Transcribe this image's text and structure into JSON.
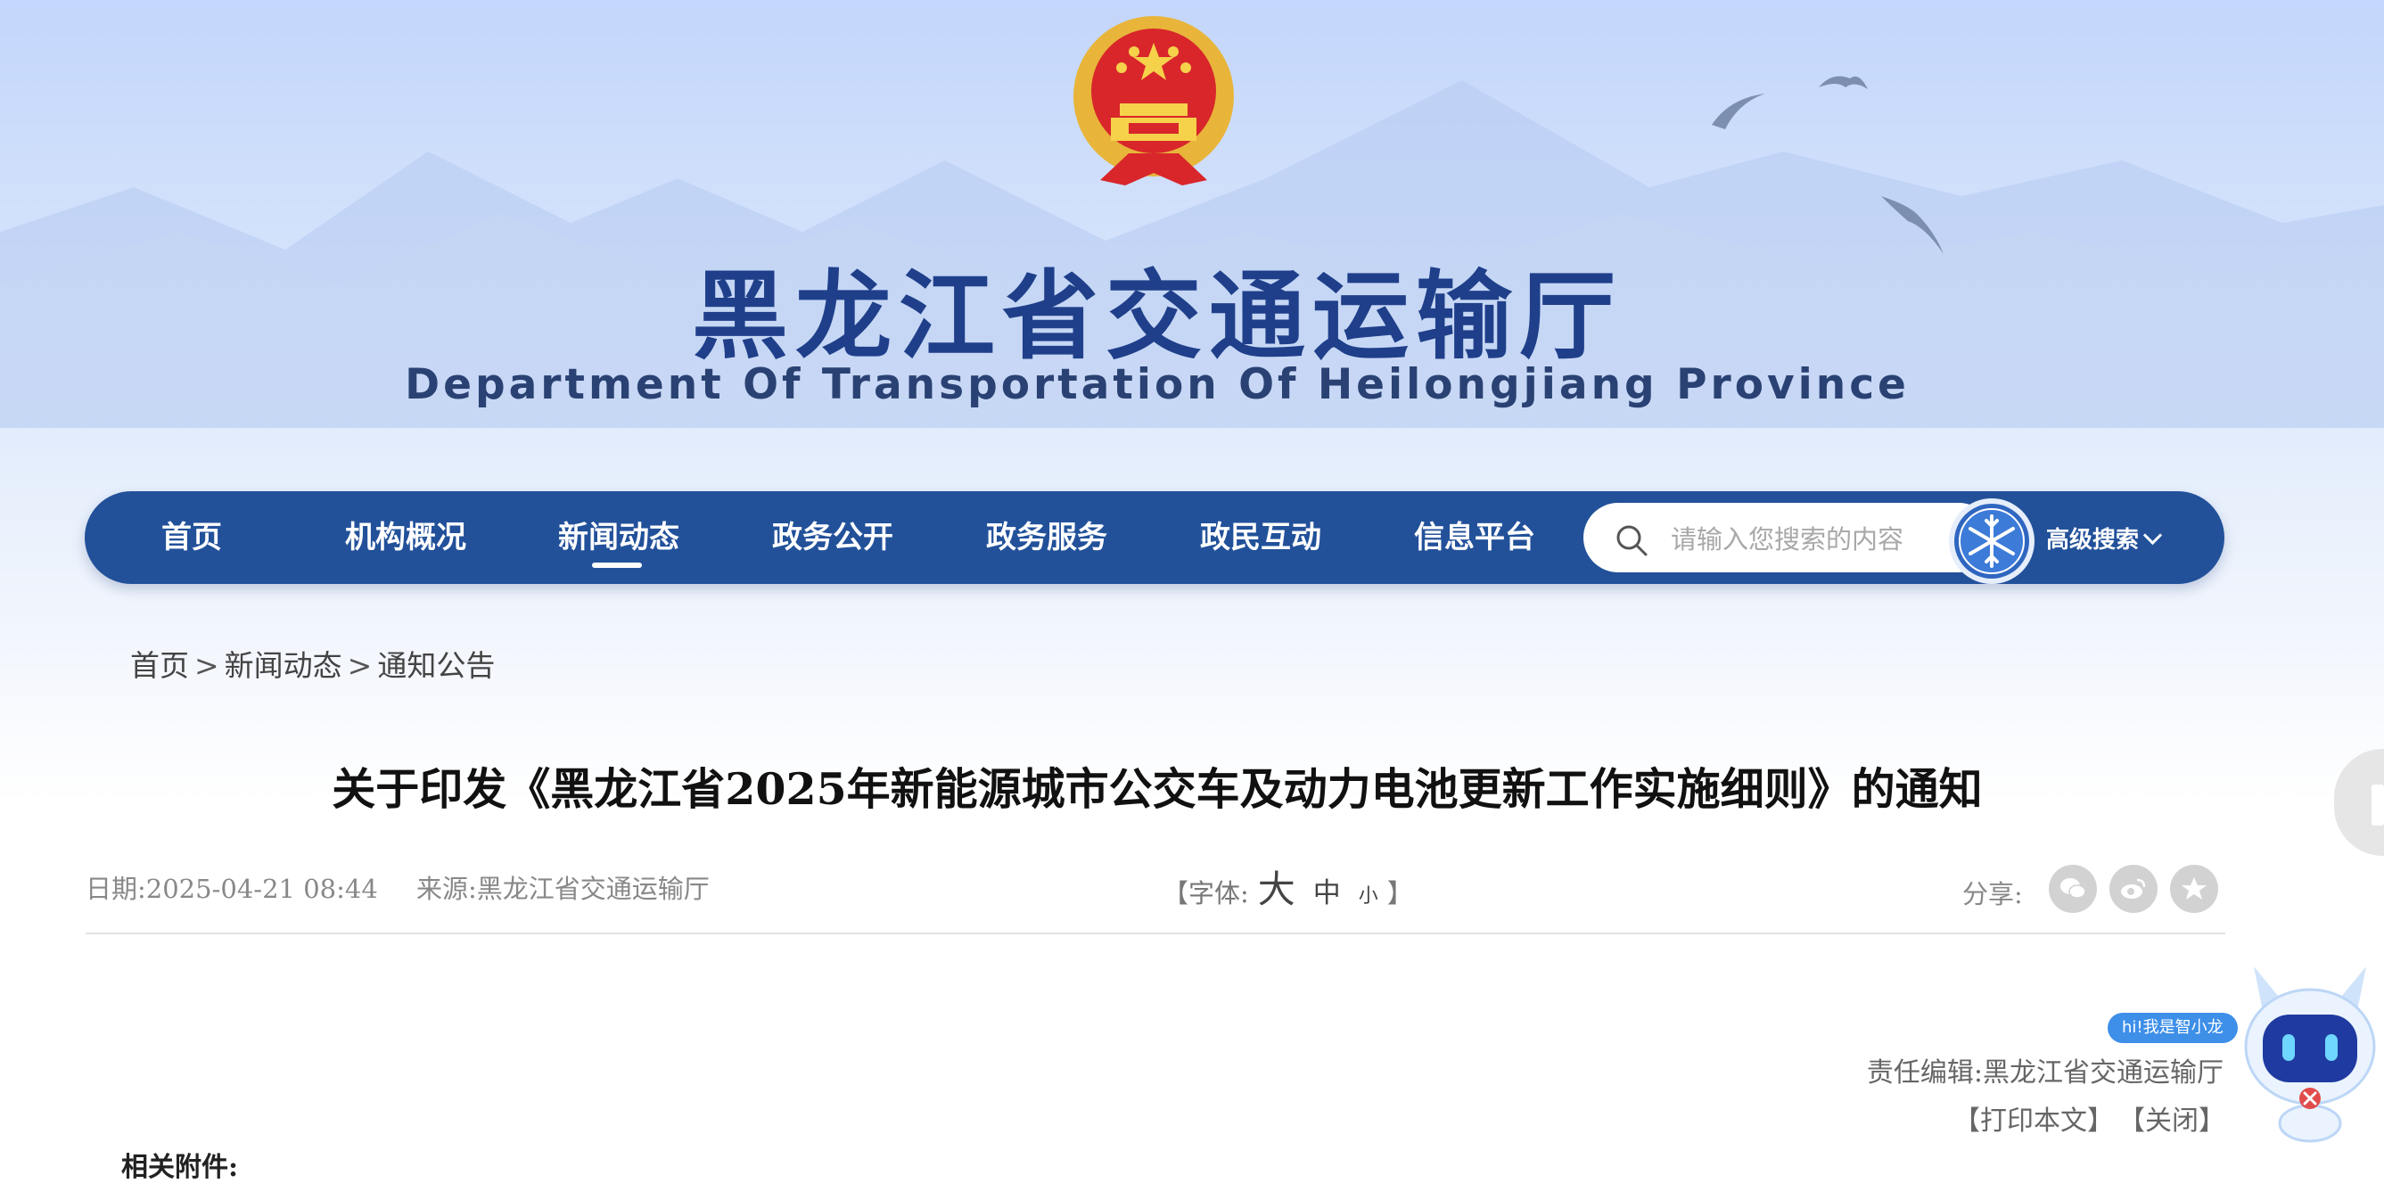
{
  "header": {
    "title_cn": "黑龙江省交通运输厅",
    "title_en": "Department Of Transportation Of Heilongjiang Province",
    "emblem": "national-emblem"
  },
  "nav": {
    "items": [
      {
        "label": "首页"
      },
      {
        "label": "机构概况"
      },
      {
        "label": "新闻动态",
        "active": true
      },
      {
        "label": "政务公开"
      },
      {
        "label": "政务服务"
      },
      {
        "label": "政民互动"
      },
      {
        "label": "信息平台"
      }
    ],
    "search_placeholder": "请输入您搜索的内容",
    "advanced_search": "高级搜索"
  },
  "breadcrumb": {
    "items": [
      "首页",
      "新闻动态",
      "通知公告"
    ],
    "separator": ">"
  },
  "article": {
    "title": "关于印发《黑龙江省2025年新能源城市公交车及动力电池更新工作实施细则》的通知",
    "date_label": "日期:",
    "date": "2025-04-21 08:44",
    "source_label": "来源:",
    "source": "黑龙江省交通运输厅",
    "font_open": "【字体:",
    "font_big": "大",
    "font_mid": "中",
    "font_small": "小",
    "font_close": "】",
    "share_label": "分享:",
    "editor_label": "责任编辑:",
    "editor": "黑龙江省交通运输厅",
    "print": "【打印本文】",
    "close": "【关闭】",
    "attachments_label": "相关附件:"
  },
  "assistant": {
    "bubble": "hi!我是智小龙"
  },
  "colors": {
    "nav_bg": "#22519a",
    "title_blue": "#1f3f8a",
    "bubble_blue": "#3d8fe8"
  }
}
